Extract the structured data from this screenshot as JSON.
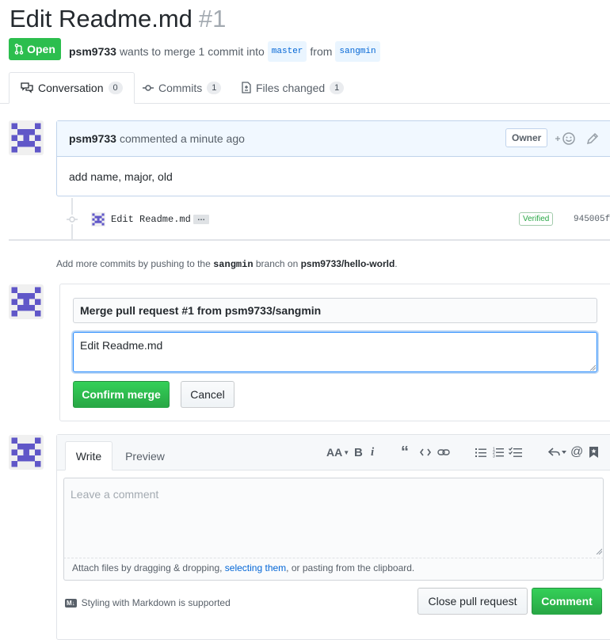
{
  "pr": {
    "title": "Edit Readme.md",
    "number": "#1",
    "state": "Open",
    "author": "psm9733",
    "merge_text": "wants to merge 1 commit into",
    "base_branch": "master",
    "from_text": "from",
    "head_branch": "sangmin"
  },
  "tabs": [
    {
      "label": "Conversation",
      "count": "0"
    },
    {
      "label": "Commits",
      "count": "1"
    },
    {
      "label": "Files changed",
      "count": "1"
    }
  ],
  "comment": {
    "author": "psm9733",
    "meta": "commented a minute ago",
    "badge": "Owner",
    "body": "add name, major, old"
  },
  "commit": {
    "message": "Edit Readme.md",
    "ellipsis": "…",
    "verified": "Verified",
    "sha": "945005f"
  },
  "hint": {
    "prefix": "Add more commits by pushing to the",
    "branch": "sangmin",
    "middle": "branch on",
    "repo": "psm9733/hello-world",
    "suffix": "."
  },
  "merge": {
    "title_value": "Merge pull request #1 from psm9733/sangmin",
    "body_value": "Edit Readme.md",
    "confirm_label": "Confirm merge",
    "cancel_label": "Cancel"
  },
  "editor": {
    "write_tab": "Write",
    "preview_tab": "Preview",
    "heading_tool": "AA",
    "bold_tool": "B",
    "italic_tool": "i",
    "placeholder": "Leave a comment",
    "attach_prefix": "Attach files by dragging & dropping,",
    "attach_link": "selecting them",
    "attach_suffix": ", or pasting from the clipboard.",
    "markdown_note": "Styling with Markdown is supported",
    "markdown_badge": "M↓",
    "close_label": "Close pull request",
    "comment_label": "Comment"
  },
  "colors": {
    "open_green": "#2cbe4e",
    "link_blue": "#0366d6",
    "avatar_purple": "#6057c8"
  }
}
